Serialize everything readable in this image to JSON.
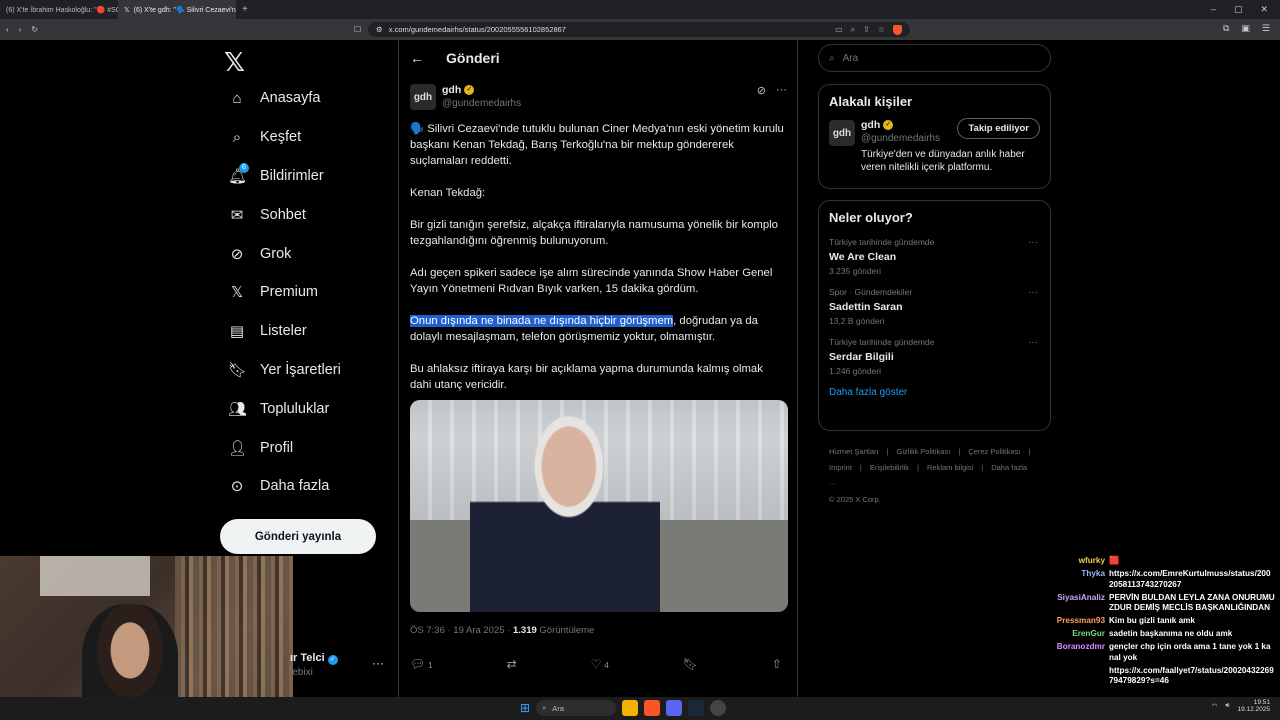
{
  "browser": {
    "tabs": [
      {
        "title": "(6) X'te İbrahim Haskoloğlu: \"🔴 #SO",
        "active": false
      },
      {
        "title": "(6) X'te gdh: \"🗣️ Silivri Cezaevi'n",
        "active": true
      }
    ],
    "url": "x.com/gundemedairhs/status/2002055556102852867"
  },
  "nav": {
    "logo": "𝕏",
    "items": [
      {
        "label": "Anasayfa",
        "icon": "home-icon"
      },
      {
        "label": "Keşfet",
        "icon": "search-icon"
      },
      {
        "label": "Bildirimler",
        "icon": "bell-icon",
        "badge": "6"
      },
      {
        "label": "Sohbet",
        "icon": "mail-icon"
      },
      {
        "label": "Grok",
        "icon": "grok-icon"
      },
      {
        "label": "Premium",
        "icon": "x-icon"
      },
      {
        "label": "Listeler",
        "icon": "list-icon"
      },
      {
        "label": "Yer İşaretleri",
        "icon": "bookmark-icon"
      },
      {
        "label": "Topluluklar",
        "icon": "people-icon"
      },
      {
        "label": "Profil",
        "icon": "person-icon"
      },
      {
        "label": "Daha fazla",
        "icon": "more-circle-icon"
      }
    ],
    "post_button": "Gönderi yayınla",
    "profile_name": "ır Telci",
    "profile_handle": "lebixi"
  },
  "post": {
    "header_title": "Gönderi",
    "author_avatar": "gdh",
    "author_name": "gdh",
    "author_handle": "@gundemedairhs",
    "paragraphs": [
      "🗣️ Silivri Cezaevi'nde tutuklu bulunan Ciner Medya'nın eski yönetim kurulu başkanı Kenan Tekdağ, Barış Terkoğlu'na bir mektup göndererek suçlamaları reddetti.",
      "Kenan Tekdağ:",
      "Bir gizli tanığın şerefsiz, alçakça iftiralarıyla namusuma yönelik bir komplo tezgahlandığını öğrenmiş bulunuyorum.",
      "Adı geçen spikeri sadece işe alım sürecinde yanında Show Haber Genel Yayın Yönetmeni Rıdvan Bıyık varken, 15 dakika gördüm."
    ],
    "highlight_text": "Onun dışında ne binada ne dışında hiçbir görüşmem",
    "highlight_rest": ", doğrudan ya da dolaylı mesajlaşmam, telefon görüşmemiz yoktur, olmamıştır.",
    "last_paragraph": "Bu ahlaksız iftiraya karşı bir açıklama yapma durumunda kalmış olmak dahi utanç vericidir.",
    "time": "ÖS 7:36 · 19 Ara 2025 · ",
    "views_count": "1.319",
    "views_label": " Görüntüleme",
    "replies": "1",
    "likes": "4"
  },
  "right": {
    "search_placeholder": "Ara",
    "related_title": "Alakalı kişiler",
    "related": {
      "avatar": "gdh",
      "name": "gdh",
      "handle": "@gundemedairhs",
      "follow_label": "Takip ediliyor",
      "bio": "Türkiye'den ve dünyadan anlık haber veren nitelikli içerik platformu."
    },
    "trends_title": "Neler oluyor?",
    "trends": [
      {
        "context": "Türkiye tarihinde gündemde",
        "title": "We Are Clean",
        "count": "3.235 gönderi"
      },
      {
        "context": "Spor · Gündemdekiler",
        "title": "Sadettin Saran",
        "count": "13,2 B gönderi"
      },
      {
        "context": "Türkiye tarihinde gündemde",
        "title": "Serdar Bilgili",
        "count": "1.246 gönderi"
      }
    ],
    "show_more": "Daha fazla göster",
    "footer_links": [
      "Hizmet Şartları",
      "|",
      "Gizlilik Politikası",
      "|",
      "Çerez Politikası",
      "|",
      "Imprint",
      "|",
      "Erişilebilirlik",
      "|",
      "Reklam bilgisi",
      "|",
      "Daha fazla ···",
      "© 2025 X Corp."
    ]
  },
  "chat": [
    {
      "name": "wfurky",
      "color": "#f5d04c",
      "text": "🟥"
    },
    {
      "name": "Thyka",
      "color": "#9ab8ff",
      "text": "https://x.com/EmreKurtulmuss/status/2002058113743270267"
    },
    {
      "name": "SiyasiAnaliz",
      "color": "#c9a6ff",
      "text": "PERVİN BULDAN LEYLA ZANA ONURUMUZDUR DEMİŞ MECLİS BAŞKANLIĞINDAN"
    },
    {
      "name": "Pressman93",
      "color": "#ff9d5c",
      "text": "Kim bu gizli tanık amk"
    },
    {
      "name": "ErenGur",
      "color": "#7cd67c",
      "text": "sadetin başkanıma ne oldu amk"
    },
    {
      "name": "Boranozdmr",
      "color": "#d98cff",
      "text": "gençler chp için orda ama 1 tane yok 1 kanal yok"
    },
    {
      "name": "",
      "color": "#ffffff",
      "text": "https://x.com/faallyet7/status/2002043226979479829?s=46"
    }
  ],
  "taskbar": {
    "search": "Ara",
    "time": "19:51",
    "date": "19.12.2025"
  }
}
